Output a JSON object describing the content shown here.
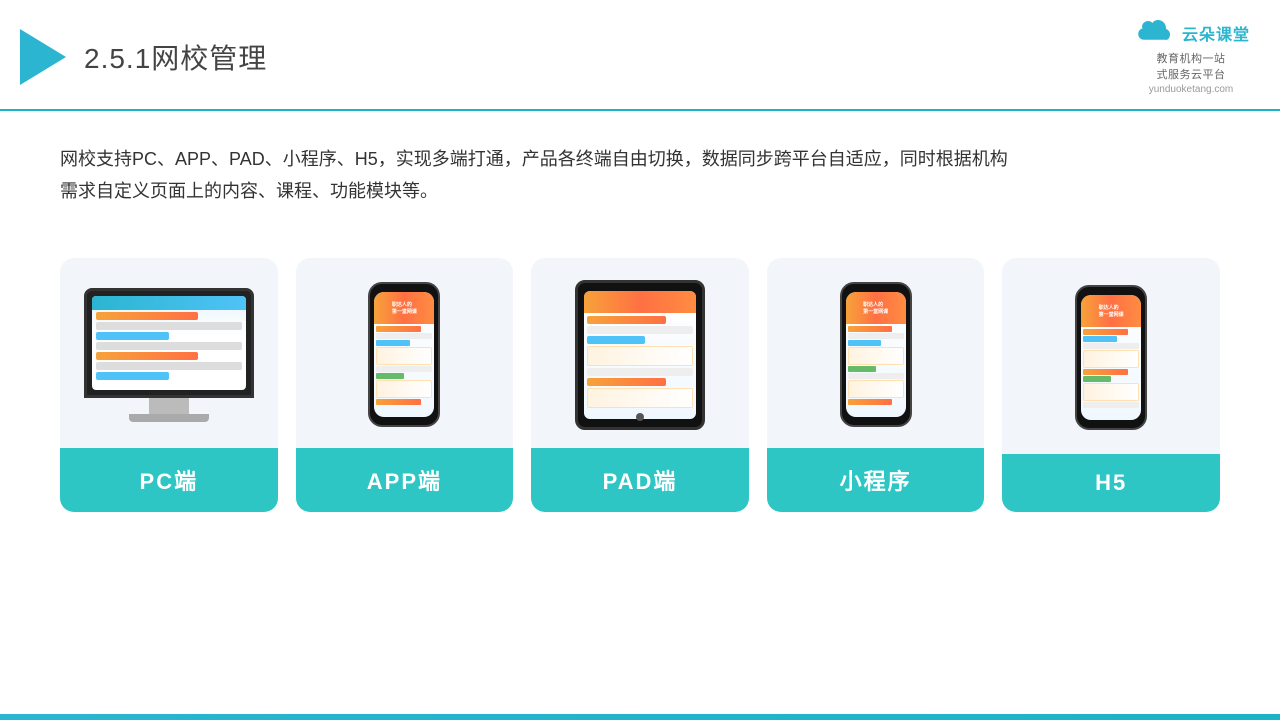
{
  "header": {
    "title_prefix": "2.5.1",
    "title_main": "网校管理"
  },
  "logo": {
    "main": "云朵课堂",
    "sub": "教育机构一站\n式服务云平台",
    "url": "yunduoketang.com"
  },
  "description": {
    "text": "网校支持PC、APP、PAD、小程序、H5，实现多端打通，产品各终端自由切换，数据同步跨平台自适应，同时根据机构\n需求自定义页面上的内容、课程、功能模块等。"
  },
  "cards": [
    {
      "id": "pc",
      "label": "PC端"
    },
    {
      "id": "app",
      "label": "APP端"
    },
    {
      "id": "pad",
      "label": "PAD端"
    },
    {
      "id": "miniprogram",
      "label": "小程序"
    },
    {
      "id": "h5",
      "label": "H5"
    }
  ]
}
